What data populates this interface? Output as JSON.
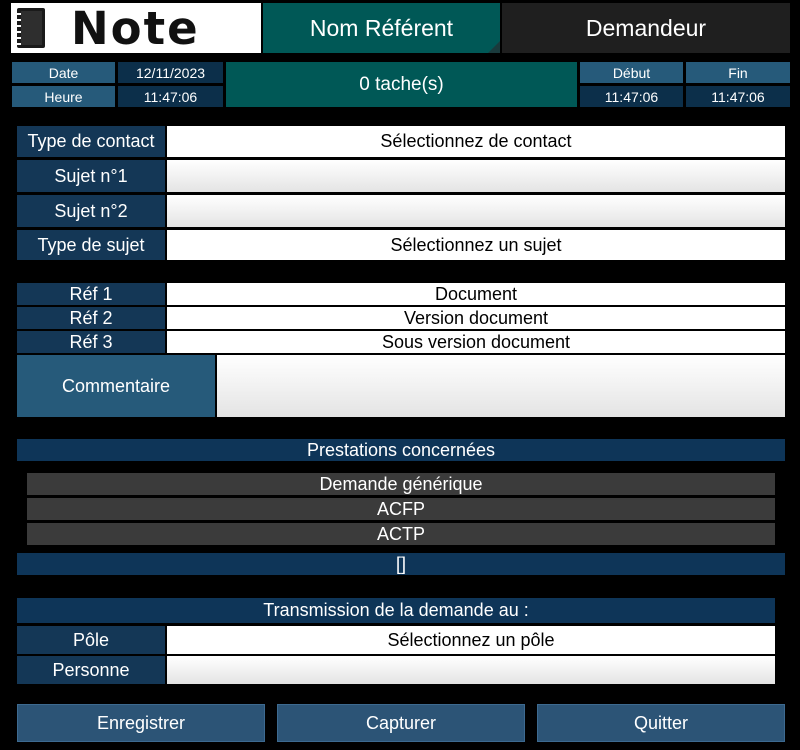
{
  "header": {
    "logo_text": "Note",
    "tab_referent": "Nom Référent",
    "tab_demandeur": "Demandeur"
  },
  "info": {
    "date_label": "Date",
    "date_value": "12/11/2023",
    "time_label": "Heure",
    "time_value": "11:47:06",
    "tasks": "0 tache(s)",
    "start_label": "Début",
    "start_value": "11:47:06",
    "end_label": "Fin",
    "end_value": "11:47:06"
  },
  "form": {
    "contact_type_label": "Type de contact",
    "contact_type_value": "Sélectionnez de contact",
    "subject1_label": "Sujet n°1",
    "subject1_value": "",
    "subject2_label": "Sujet n°2",
    "subject2_value": "",
    "subject_type_label": "Type de sujet",
    "subject_type_value": "Sélectionnez un sujet",
    "ref1_label": "Réf 1",
    "ref1_value": "Document",
    "ref2_label": "Réf 2",
    "ref2_value": "Version document",
    "ref3_label": "Réf 3",
    "ref3_value": "Sous version document",
    "comment_label": "Commentaire",
    "comment_value": ""
  },
  "prestations": {
    "title": "Prestations concernées",
    "items": [
      "Demande générique",
      "ACFP",
      "ACTP"
    ],
    "footer": "[]"
  },
  "transmission": {
    "title": "Transmission de la demande au :",
    "pole_label": "Pôle",
    "pole_value": "Sélectionnez un pôle",
    "person_label": "Personne",
    "person_value": ""
  },
  "buttons": {
    "save": "Enregistrer",
    "capture": "Capturer",
    "quit": "Quitter"
  }
}
